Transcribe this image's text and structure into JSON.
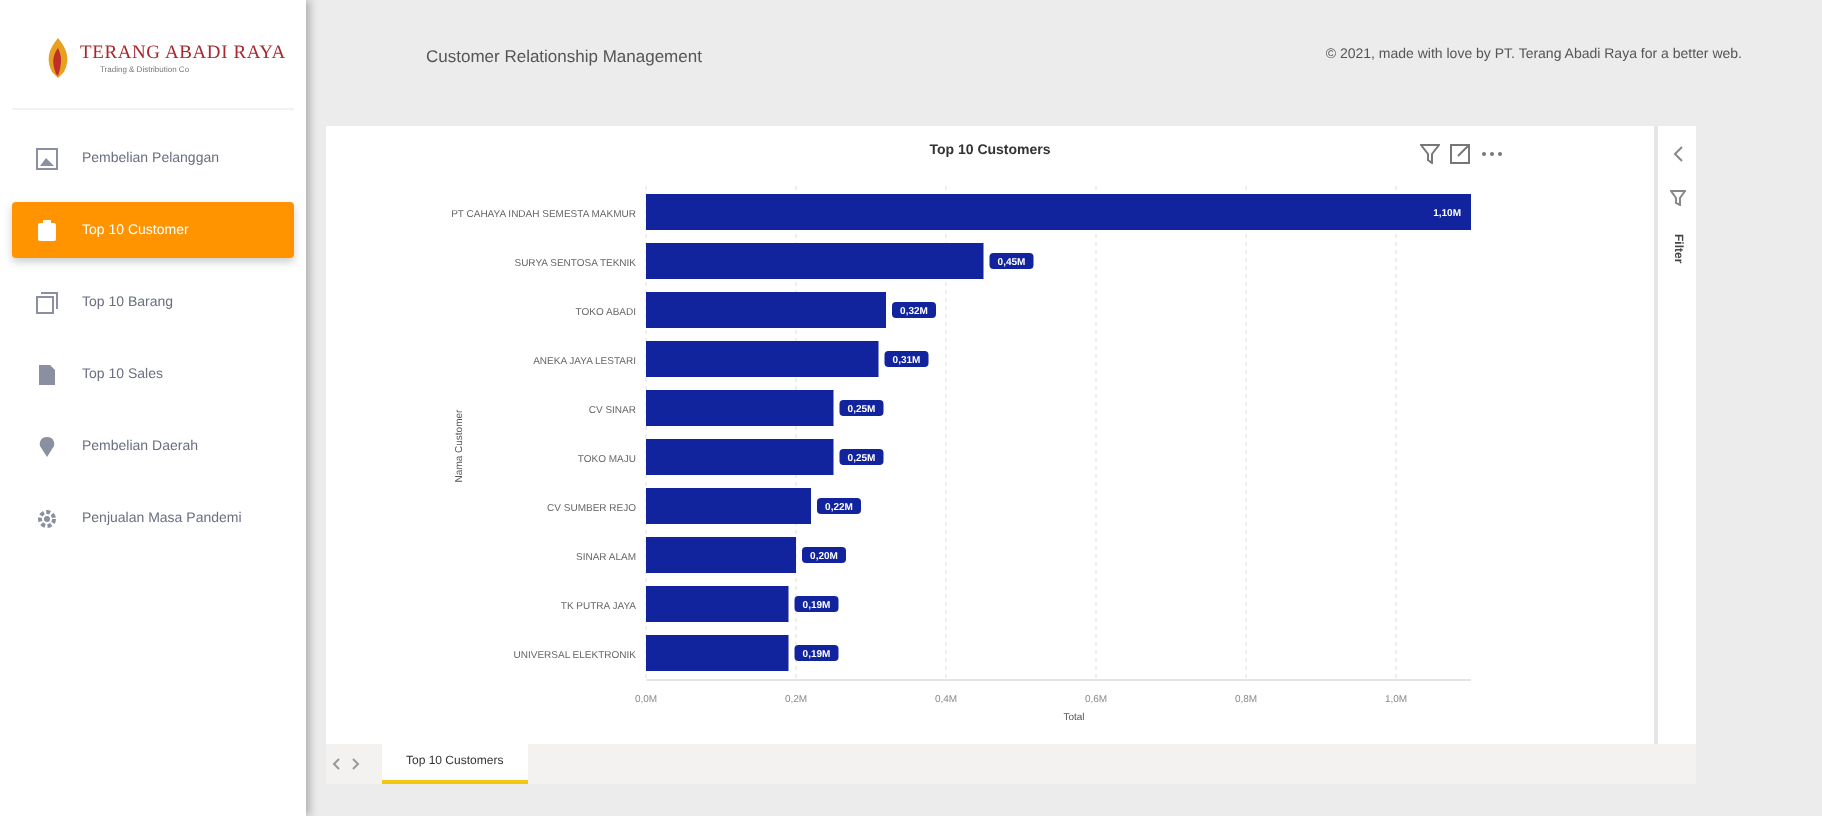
{
  "brand": {
    "name": "TERANG ABADI RAYA",
    "tagline": "Trading & Distribution Co"
  },
  "sidebar": {
    "items": [
      {
        "label": "Pembelian Pelanggan",
        "selected": false
      },
      {
        "label": "Top 10 Customer",
        "selected": true
      },
      {
        "label": "Top 10 Barang",
        "selected": false
      },
      {
        "label": "Top 10 Sales",
        "selected": false
      },
      {
        "label": "Pembelian Daerah",
        "selected": false
      },
      {
        "label": "Penjualan Masa Pandemi",
        "selected": false
      }
    ]
  },
  "header": {
    "title": "Customer Relationship Management",
    "credit": "© 2021, made with love by PT. Terang Abadi Raya for a better web."
  },
  "report": {
    "filter_label": "Filter",
    "chart_data": {
      "type": "bar",
      "orientation": "horizontal",
      "title": "Top 10 Customers",
      "xlabel": "Total",
      "ylabel": "Nama Customer",
      "categories": [
        "PT CAHAYA INDAH SEMESTA MAKMUR",
        "SURYA SENTOSA TEKNIK",
        "TOKO ABADI",
        "ANEKA JAYA LESTARI",
        "CV SINAR",
        "TOKO MAJU",
        "CV SUMBER REJO",
        "SINAR ALAM",
        "TK PUTRA JAYA",
        "UNIVERSAL ELEKTRONIK"
      ],
      "series": [
        {
          "color": "#12239e",
          "values": [
            1.1,
            0.45,
            0.32,
            0.31,
            0.25,
            0.25,
            0.22,
            0.2,
            0.19,
            0.19
          ]
        }
      ],
      "grid": true,
      "xlim": [
        0,
        1.1
      ],
      "value_labels": [
        "1,10M",
        "0,45M",
        "0,32M",
        "0,31M",
        "0,25M",
        "0,25M",
        "0,22M",
        "0,20M",
        "0,19M",
        "0,19M"
      ],
      "xticks": [
        {
          "value": 0,
          "label": "0,0M"
        },
        {
          "value": 0.2,
          "label": "0,2M"
        },
        {
          "value": 0.4,
          "label": "0,4M"
        },
        {
          "value": 0.6,
          "label": "0,6M"
        },
        {
          "value": 0.8,
          "label": "0,8M"
        },
        {
          "value": 1.0,
          "label": "1,0M"
        }
      ]
    }
  },
  "page_tabs": [
    {
      "label": "Top 10 Customers",
      "selected": true
    }
  ]
}
